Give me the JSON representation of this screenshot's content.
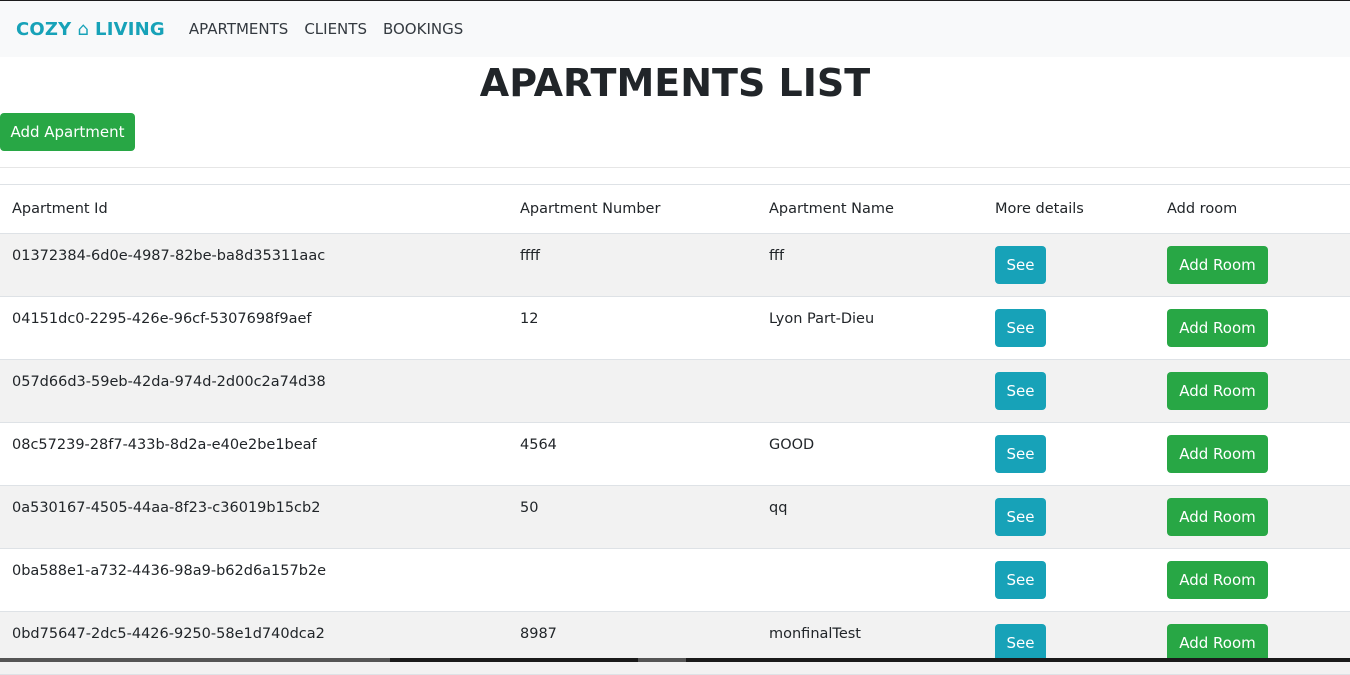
{
  "nav": {
    "brand_left": "COZY",
    "brand_icon": "house-icon",
    "brand_icon_glyph": "⌂",
    "brand_right": "LIVING",
    "links": [
      "APARTMENTS",
      "CLIENTS",
      "BOOKINGS"
    ]
  },
  "page": {
    "title": "APARTMENTS LIST",
    "add_button": "Add Apartment"
  },
  "table": {
    "headers": [
      "Apartment Id",
      "Apartment Number",
      "Apartment Name",
      "More details",
      "Add room"
    ],
    "see_label": "See",
    "add_room_label": "Add Room",
    "rows": [
      {
        "id": "01372384-6d0e-4987-82be-ba8d35311aac",
        "number": "ffff",
        "name": "fff"
      },
      {
        "id": "04151dc0-2295-426e-96cf-5307698f9aef",
        "number": "12",
        "name": "Lyon Part-Dieu"
      },
      {
        "id": "057d66d3-59eb-42da-974d-2d00c2a74d38",
        "number": "",
        "name": ""
      },
      {
        "id": "08c57239-28f7-433b-8d2a-e40e2be1beaf",
        "number": "4564",
        "name": "GOOD"
      },
      {
        "id": "0a530167-4505-44aa-8f23-c36019b15cb2",
        "number": "50",
        "name": "qq"
      },
      {
        "id": "0ba588e1-a732-4436-98a9-b62d6a157b2e",
        "number": "",
        "name": ""
      },
      {
        "id": "0bd75647-2dc5-4426-9250-58e1d740dca2",
        "number": "8987",
        "name": "monfinalTest"
      }
    ]
  },
  "colors": {
    "brand": "#17a2b8",
    "success": "#28a745",
    "info": "#17a2b8",
    "navbar_bg": "#f8f9fa",
    "stripe_bg": "#f2f2f2"
  }
}
